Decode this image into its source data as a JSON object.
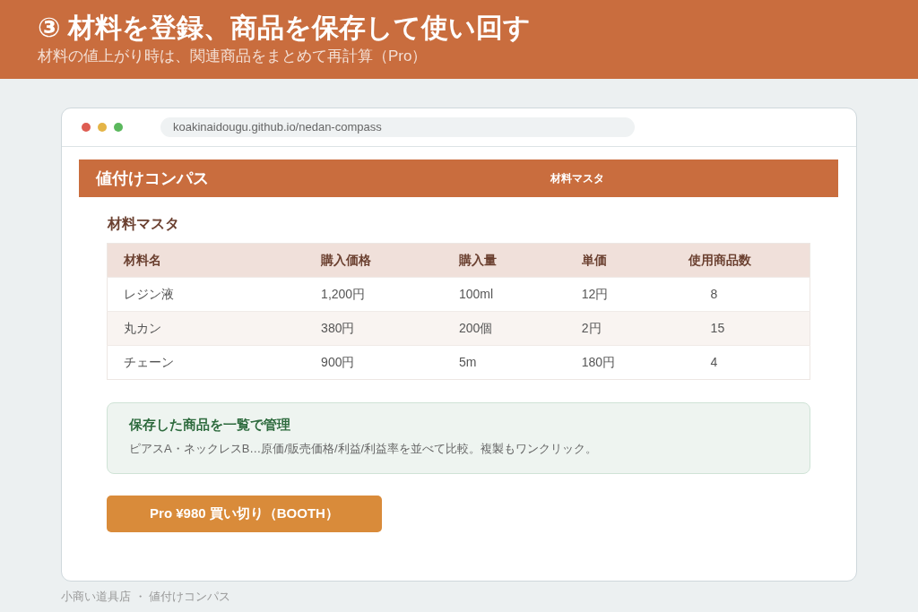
{
  "slide": {
    "title": "③ 材料を登録、商品を保存して使い回す",
    "subtitle": "材料の値上がり時は、関連商品をまとめて再計算（Pro）"
  },
  "browser": {
    "url": "koakinaidougu.github.io/nedan-compass"
  },
  "app": {
    "brand": "値付けコンパス",
    "nav_items": [
      "材料マスタ"
    ]
  },
  "section_title": "材料マスタ",
  "table": {
    "columns": [
      "材料名",
      "購入価格",
      "購入量",
      "単価",
      "使用商品数"
    ],
    "rows": [
      [
        "レジン液",
        "1,200円",
        "100ml",
        "12円",
        "8"
      ],
      [
        "丸カン",
        "380円",
        "200個",
        "2円",
        "15"
      ],
      [
        "チェーン",
        "900円",
        "5m",
        "180円",
        "4"
      ]
    ]
  },
  "info_box": {
    "title": "保存した商品を一覧で管理",
    "text": "ピアスA・ネックレスB…原価/販売価格/利益/利益率を並べて比較。複製もワンクリック。"
  },
  "buy_button": {
    "label": "Pro ¥980 買い切り（BOOTH）"
  },
  "footer": "小商い道具店 ・ 値付けコンパス"
}
